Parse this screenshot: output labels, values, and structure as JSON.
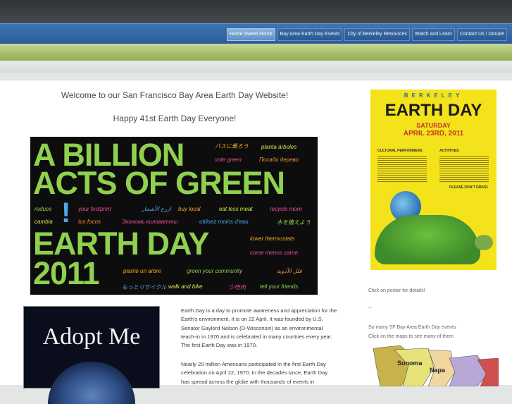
{
  "nav": {
    "items": [
      {
        "label": "Home Sweet Home",
        "active": true
      },
      {
        "label": "Bay Area Earth Day Events",
        "active": false
      },
      {
        "label": "City of Berkeley Resources",
        "active": false
      },
      {
        "label": "Watch and Learn",
        "active": false
      },
      {
        "label": "Contact Us / Donate",
        "active": false
      }
    ]
  },
  "main": {
    "welcome": "Welcome to our San Francisco Bay Area Earth Day Website!",
    "happy": "Happy 41st Earth Day Everyone!",
    "banner": {
      "lines": [
        "A BILLION",
        "ACTS OF GREEN",
        "!",
        "EARTH DAY",
        "2011"
      ],
      "phrases": [
        "バスに乗ろう",
        "planta árboles",
        "vote green",
        "Посади дерево",
        "reduce",
        "your footprint",
        "ازرع الأشجار",
        "buy local",
        "eat less meat",
        "recycle more",
        "cambia",
        "tus focos",
        "Экономь киловатты",
        "utilisez moins d'eau",
        "木を植えよう",
        "lower thermostats",
        "come menos carne",
        "plante un arbre",
        "green your community",
        "قلل الأذوية",
        "もっとリサイクル",
        "walk and bike",
        "少吃肉",
        "tell your friends"
      ]
    },
    "adopt": {
      "text": "Adopt Me"
    },
    "paragraphs": [
      "Earth Day is a day to promote awareness and appreciation for the Earth's environment. It is on 22 April. It was founded by U.S. Senator Gaylord Nelson (D-Wisconsin) as an environmental teach-in in 1970 and is celebrated in many countries every year. The first Earth Day was in 1970.",
      "Nearly 20 million Americans participated in the first Earth Day celebration on April 22, 1970. In the decades since, Earth Day has spread across the globe with thousands of events in"
    ]
  },
  "sidebar": {
    "poster": {
      "top": "BERKELEY",
      "title": "EARTH DAY",
      "day": "SATURDAY",
      "date": "APRIL 23RD, 2011",
      "sub1": "CULTURAL PERFORMERS",
      "sub2": "ACTIVITIES",
      "sub3": "PLEASE DON'T DRIVE!"
    },
    "poster_caption": "Click on poster for details!",
    "dash": "--",
    "events_text": "So many SF Bay Area Earth Day events",
    "maps_text": "Click on the maps to see many of them",
    "map_labels": [
      "Sonoma",
      "Napa"
    ]
  },
  "colors": {
    "nav_blue": "#2d5d98",
    "green_band": "#a6c06a",
    "poster_yellow": "#f4e21b"
  }
}
